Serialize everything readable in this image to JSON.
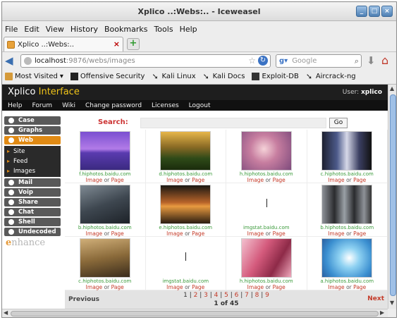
{
  "window": {
    "title": "Xplico ..:Webs:.. - Iceweasel"
  },
  "menu": [
    "File",
    "Edit",
    "View",
    "History",
    "Bookmarks",
    "Tools",
    "Help"
  ],
  "tab": {
    "label": "Xplico ..:Webs:..",
    "close": "×"
  },
  "urlbar": {
    "host": "localhost",
    "path": ":9876/webs/images"
  },
  "searchbar": {
    "placeholder": "Google"
  },
  "bookmarks": [
    {
      "label": "Most Visited",
      "icon": "folder-icon"
    },
    {
      "label": "Offensive Security",
      "icon": "offensive-security-icon"
    },
    {
      "label": "Kali Linux",
      "icon": "kali-dragon-icon"
    },
    {
      "label": "Kali Docs",
      "icon": "kali-dragon-icon"
    },
    {
      "label": "Exploit-DB",
      "icon": "exploit-db-icon"
    },
    {
      "label": "Aircrack-ng",
      "icon": "kali-dragon-icon"
    }
  ],
  "header": {
    "title_main": "Xplico",
    "title_accent": "Interface",
    "user_label": "User:",
    "user_name": "xplico",
    "accent_color": "#f0c419"
  },
  "nav": [
    "Help",
    "Forum",
    "Wiki",
    "Change password",
    "Licenses",
    "Logout"
  ],
  "sidebar": {
    "top": [
      {
        "label": "Case"
      },
      {
        "label": "Graphs"
      },
      {
        "label": "Web",
        "active": true
      }
    ],
    "sub": [
      {
        "label": "Site"
      },
      {
        "label": "Feed"
      },
      {
        "label": "Images"
      }
    ],
    "bottom": [
      {
        "label": "Mail"
      },
      {
        "label": "Voip"
      },
      {
        "label": "Share"
      },
      {
        "label": "Chat"
      },
      {
        "label": "Shell"
      },
      {
        "label": "Undecoded"
      }
    ],
    "enhance_first": "e",
    "enhance_rest": "nhance"
  },
  "search": {
    "label": "Search:",
    "go": "Go"
  },
  "links": {
    "image": "Image",
    "or": "or",
    "page": "Page"
  },
  "images": [
    {
      "host": "f.hiphotos.baidu.com",
      "icon": "purple-lake-photo"
    },
    {
      "host": "d.hiphotos.baidu.com",
      "icon": "sunflower-field-photo"
    },
    {
      "host": "h.hiphotos.baidu.com",
      "icon": "girl-portrait-photo"
    },
    {
      "host": "c.hiphotos.baidu.com",
      "icon": "anime-figures-photo"
    },
    {
      "host": "b.hiphotos.baidu.com",
      "icon": "car-street-photo"
    },
    {
      "host": "e.hiphotos.baidu.com",
      "icon": "sunset-lake-photo"
    },
    {
      "host": "imgstat.baidu.com",
      "icon": "empty-image"
    },
    {
      "host": "b.hiphotos.baidu.com",
      "icon": "band-group-photo"
    },
    {
      "host": "c.hiphotos.baidu.com",
      "icon": "offroad-car-photo"
    },
    {
      "host": "imgstat.baidu.com",
      "icon": "empty-image"
    },
    {
      "host": "h.hiphotos.baidu.com",
      "icon": "pink-artwork-photo"
    },
    {
      "host": "a.hiphotos.baidu.com",
      "icon": "blue-abstract-photo"
    }
  ],
  "pager": {
    "prev": "Previous",
    "next": "Next",
    "pages": [
      "1",
      "2",
      "3",
      "4",
      "5",
      "6",
      "7",
      "8",
      "9"
    ],
    "current": "1",
    "of_text": "1 of 45"
  }
}
